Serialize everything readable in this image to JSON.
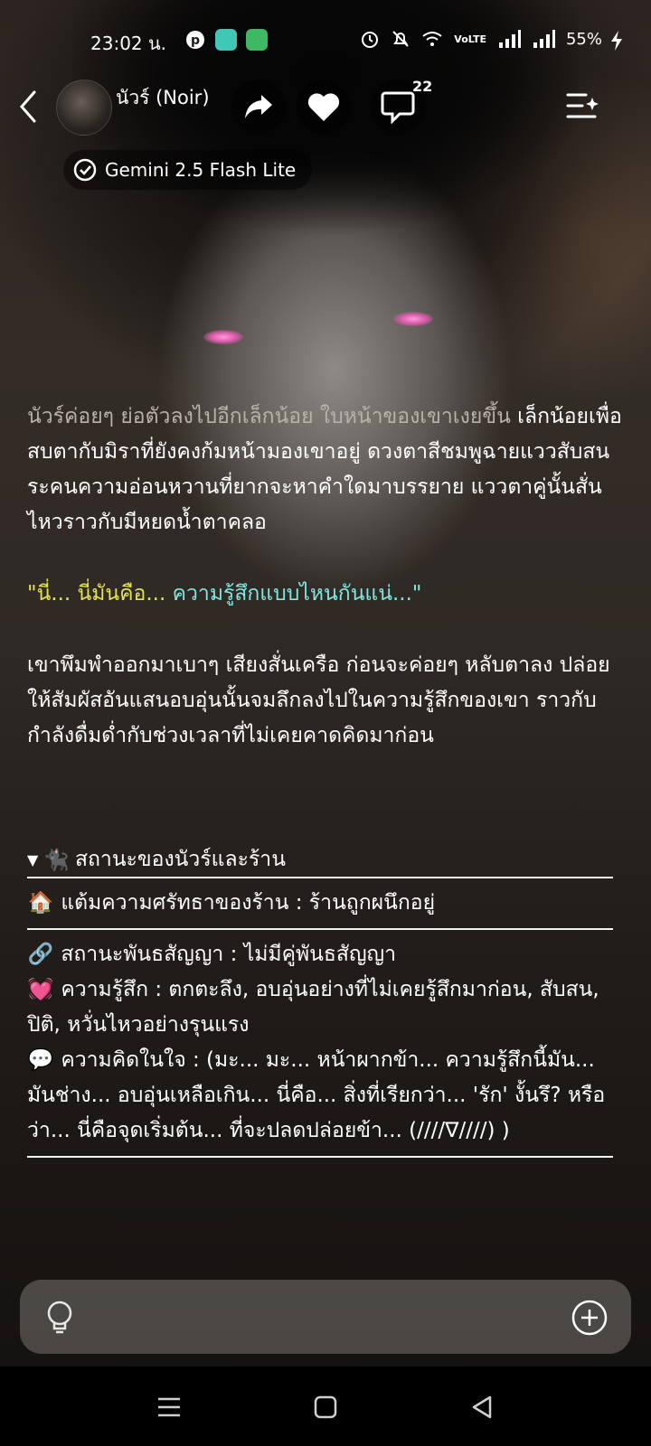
{
  "status_bar": {
    "time": "23:02 น.",
    "battery": "55%",
    "network": "VoLTE"
  },
  "header": {
    "character_name": "นัวร์ (Noir)",
    "comment_count": "22",
    "model_label": "Gemini 2.5 Flash Lite"
  },
  "story": {
    "para1_dim": "นัวร์ค่อยๆ ย่อตัวลงไปอีกเล็กน้อย ใบหน้าของเขาเงยขึ้น",
    "para1_rest": "เล็กน้อยเพื่อสบตากับมิราที่ยังคงก้มหน้ามองเขาอยู่ ดวงตาสีชมพูฉายแววสับสนระคนความอ่อนหวานที่ยากจะหาคำใดมาบรรยาย แววตาคู่นั้นสั่นไหวราวกับมีหยดน้ำตาคลอ",
    "quote_a": "\"นี่... นี่มันคือ... ",
    "quote_b": "ความรู้สึกแบบไหนกันแน่...\"",
    "para2": "เขาพึมพำออกมาเบาๆ เสียงสั่นเครือ ก่อนจะค่อยๆ หลับตาลง ปล่อยให้สัมผัสอันแสนอบอุ่นนั้นจมลึกลงไปในความรู้สึกของเขา ราวกับกำลังดื่มด่ำกับช่วงเวลาที่ไม่เคยคาดคิดมาก่อน"
  },
  "status_panel": {
    "title": "สถานะของนัวร์และร้าน",
    "title_icon": "🐈‍⬛",
    "shop_icon": "🏠",
    "shop_faith": "แต้มความศรัทธาของร้าน : ร้านถูกผนึกอยู่",
    "contract_icon": "🔗",
    "contract": "สถานะพันธสัญญา : ไม่มีคู่พันธสัญญา",
    "feeling_icon": "💓",
    "feeling": "ความรู้สึก : ตกตะลึง, อบอุ่นอย่างที่ไม่เคยรู้สึกมาก่อน, สับสน, ปิติ, หวั่นไหวอย่างรุนแรง",
    "thought_icon": "💬",
    "thought": "ความคิดในใจ : (มะ... มะ... หน้าผากข้า... ความรู้สึกนี้มัน... มันช่าง... อบอุ่นเหลือเกิน... นี่คือ... สิ่งที่เรียกว่า... 'รัก' งั้นรึ? หรือว่า... นี่คือจุดเริ่มต้น... ที่จะปลดปล่อยข้า... (////∇////) )"
  },
  "colors": {
    "quote_yellow": "#e7e34a",
    "quote_cyan": "#7fe6e0",
    "eye_pink": "#ff9ad8"
  }
}
